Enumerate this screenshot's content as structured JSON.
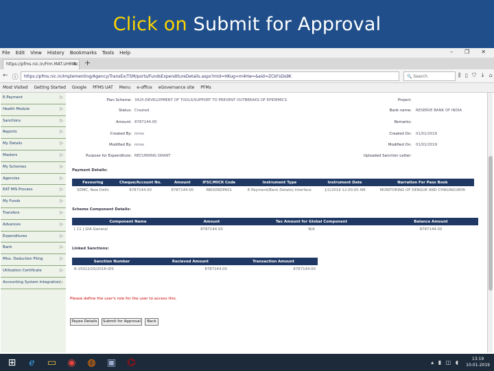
{
  "banner": {
    "prefix": "Click on",
    "rest": " Submit for Approval"
  },
  "browser": {
    "menu": [
      "File",
      "Edit",
      "View",
      "History",
      "Bookmarks",
      "Tools",
      "Help"
    ],
    "tab_title": "https://pfms.nic.in/Frm.MAT.UHM&c",
    "url": "https://pfms.nic.in/Implementing/Agency/TransEx/TSM/ports/FundsExpenditureDetails.aspx?mid=HKug=m4Hw=&eid=ZCkFsDs9K",
    "search_placeholder": "Search",
    "bookmarks": [
      "Most Visited",
      "Getting Started",
      "Google",
      "PFMS UAT",
      "Menu",
      "e-office",
      "eGovernance site",
      "PFMs"
    ]
  },
  "sidebar": {
    "items": [
      "E-Payment",
      "Health Module",
      "Sanctions",
      "Reports",
      "My Details",
      "Masters",
      "My Schemes",
      "Agencies",
      "EAT MIS Process",
      "My Funds",
      "Transfers",
      "Advances",
      "Expenditures",
      "Bank",
      "Miss. Deduction Filing",
      "Utilization Certificate",
      "Accounting System Integration"
    ]
  },
  "details": {
    "plan_scheme_label": "Plan Scheme:",
    "plan_scheme_value": "3425-DEVELOPMENT OF TOOLS/SUPPORT TO PREVENT OUTBREAKS OF EPIDEMICS",
    "project_label": "Project:",
    "status_label": "Status:",
    "status_value": "Created",
    "bank_label": "Bank name:",
    "bank_value": "RESERVE BANK OF INDIA",
    "amount_label": "Amount:",
    "amount_value": "8787144.00",
    "remarks_label": "Remarks:",
    "created_by_label": "Created By:",
    "created_by_value": "nrrvs",
    "created_on_label": "Created On:",
    "created_on_value": "01/01/2019",
    "modified_by_label": "Modified By:",
    "modified_by_value": "nrrvs",
    "modified_on_label": "Modified On:",
    "modified_on_value": "01/01/2019",
    "purpose_label": "Purpose for Expenditure:",
    "purpose_value": "RECURRING GRANT",
    "uploaded_label": "Uploaded Sanction Letter:"
  },
  "payment": {
    "title": "Payment Details:",
    "headers": [
      "Favouring",
      "Cheque/Account No.",
      "Amount",
      "IFSC/MICR Code",
      "Instrument Type",
      "Instrument Date",
      "Narration For Pass Book"
    ],
    "row": [
      "SDMC, New Delhi",
      "8787144.00",
      "8787144.00",
      "RBIS0NDPA01",
      "E-Payment(Bank Details) Interface",
      "1/1/2019 12:00:00 AM",
      "MONITORING OF DENGUE AND CHIKUNGUNYA"
    ]
  },
  "scheme": {
    "title": "Scheme Component Details:",
    "headers": [
      "Component Name",
      "Amount",
      "Tax Amount for Global Component",
      "Balance Amount"
    ],
    "row": [
      "[ 11 ] GIA-General",
      "8787144.00",
      "N/A",
      "8787144.00"
    ]
  },
  "linked": {
    "title": "Linked Sanctions:",
    "headers": [
      "Sanction Number",
      "Recieved Amount",
      "Transaction Amount"
    ],
    "row": [
      "R-15012/20/2018-IDS",
      "8787144.00",
      "8787144.00"
    ]
  },
  "error": "Please define the user's role for the user to access this.",
  "buttons": {
    "payee": "Payee Details",
    "submit": "Submit for Approval",
    "back": "Back"
  },
  "taskbar": {
    "time": "13:19",
    "date": "10-01-2019"
  }
}
